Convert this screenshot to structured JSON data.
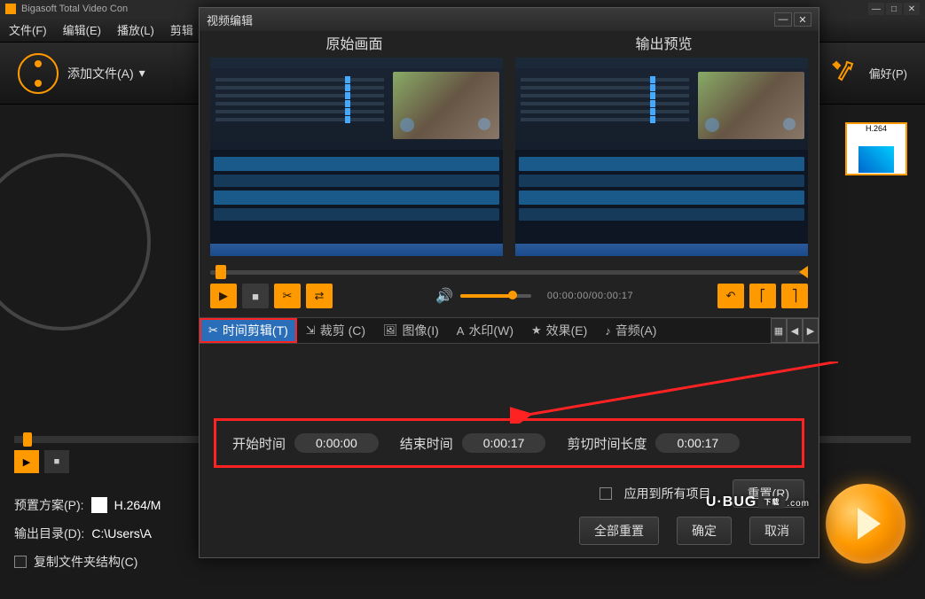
{
  "mainWindow": {
    "title": "Bigasoft Total Video Con",
    "menubar": {
      "file": "文件(F)",
      "edit": "编辑(E)",
      "play": "播放(L)",
      "trim": "剪辑"
    },
    "toolbar": {
      "addFile": "添加文件(A)",
      "prefs": "偏好(P)"
    },
    "formatThumb": {
      "label": "H.264"
    },
    "bottomPanel": {
      "presetLabel": "预置方案(P):",
      "presetValue": "H.264/M",
      "outputLabel": "输出目录(D):",
      "outputValue": "C:\\Users\\A",
      "copyStructLabel": "复制文件夹结构(C)"
    }
  },
  "dialog": {
    "title": "视频编辑",
    "headers": {
      "left": "原始画面",
      "right": "输出预览"
    },
    "timeDisplay": "00:00:00/00:00:17",
    "tabs": {
      "trim": "时间剪辑(T)",
      "crop": "裁剪 (C)",
      "image": "图像(I)",
      "watermark": "水印(W)",
      "effect": "效果(E)",
      "audio": "音频(A)"
    },
    "trimFields": {
      "startLabel": "开始时间",
      "startValue": "0:00:00",
      "endLabel": "结束时间",
      "endValue": "0:00:17",
      "lengthLabel": "剪切时间长度",
      "lengthValue": "0:00:17"
    },
    "footer": {
      "applyAll": "应用到所有项目",
      "reset": "重置(R)",
      "resetAll": "全部重置",
      "ok": "确定",
      "cancel": "取消"
    }
  },
  "watermark": {
    "brand": "U·BUG",
    "suffix": ".com",
    "download": "下载"
  }
}
